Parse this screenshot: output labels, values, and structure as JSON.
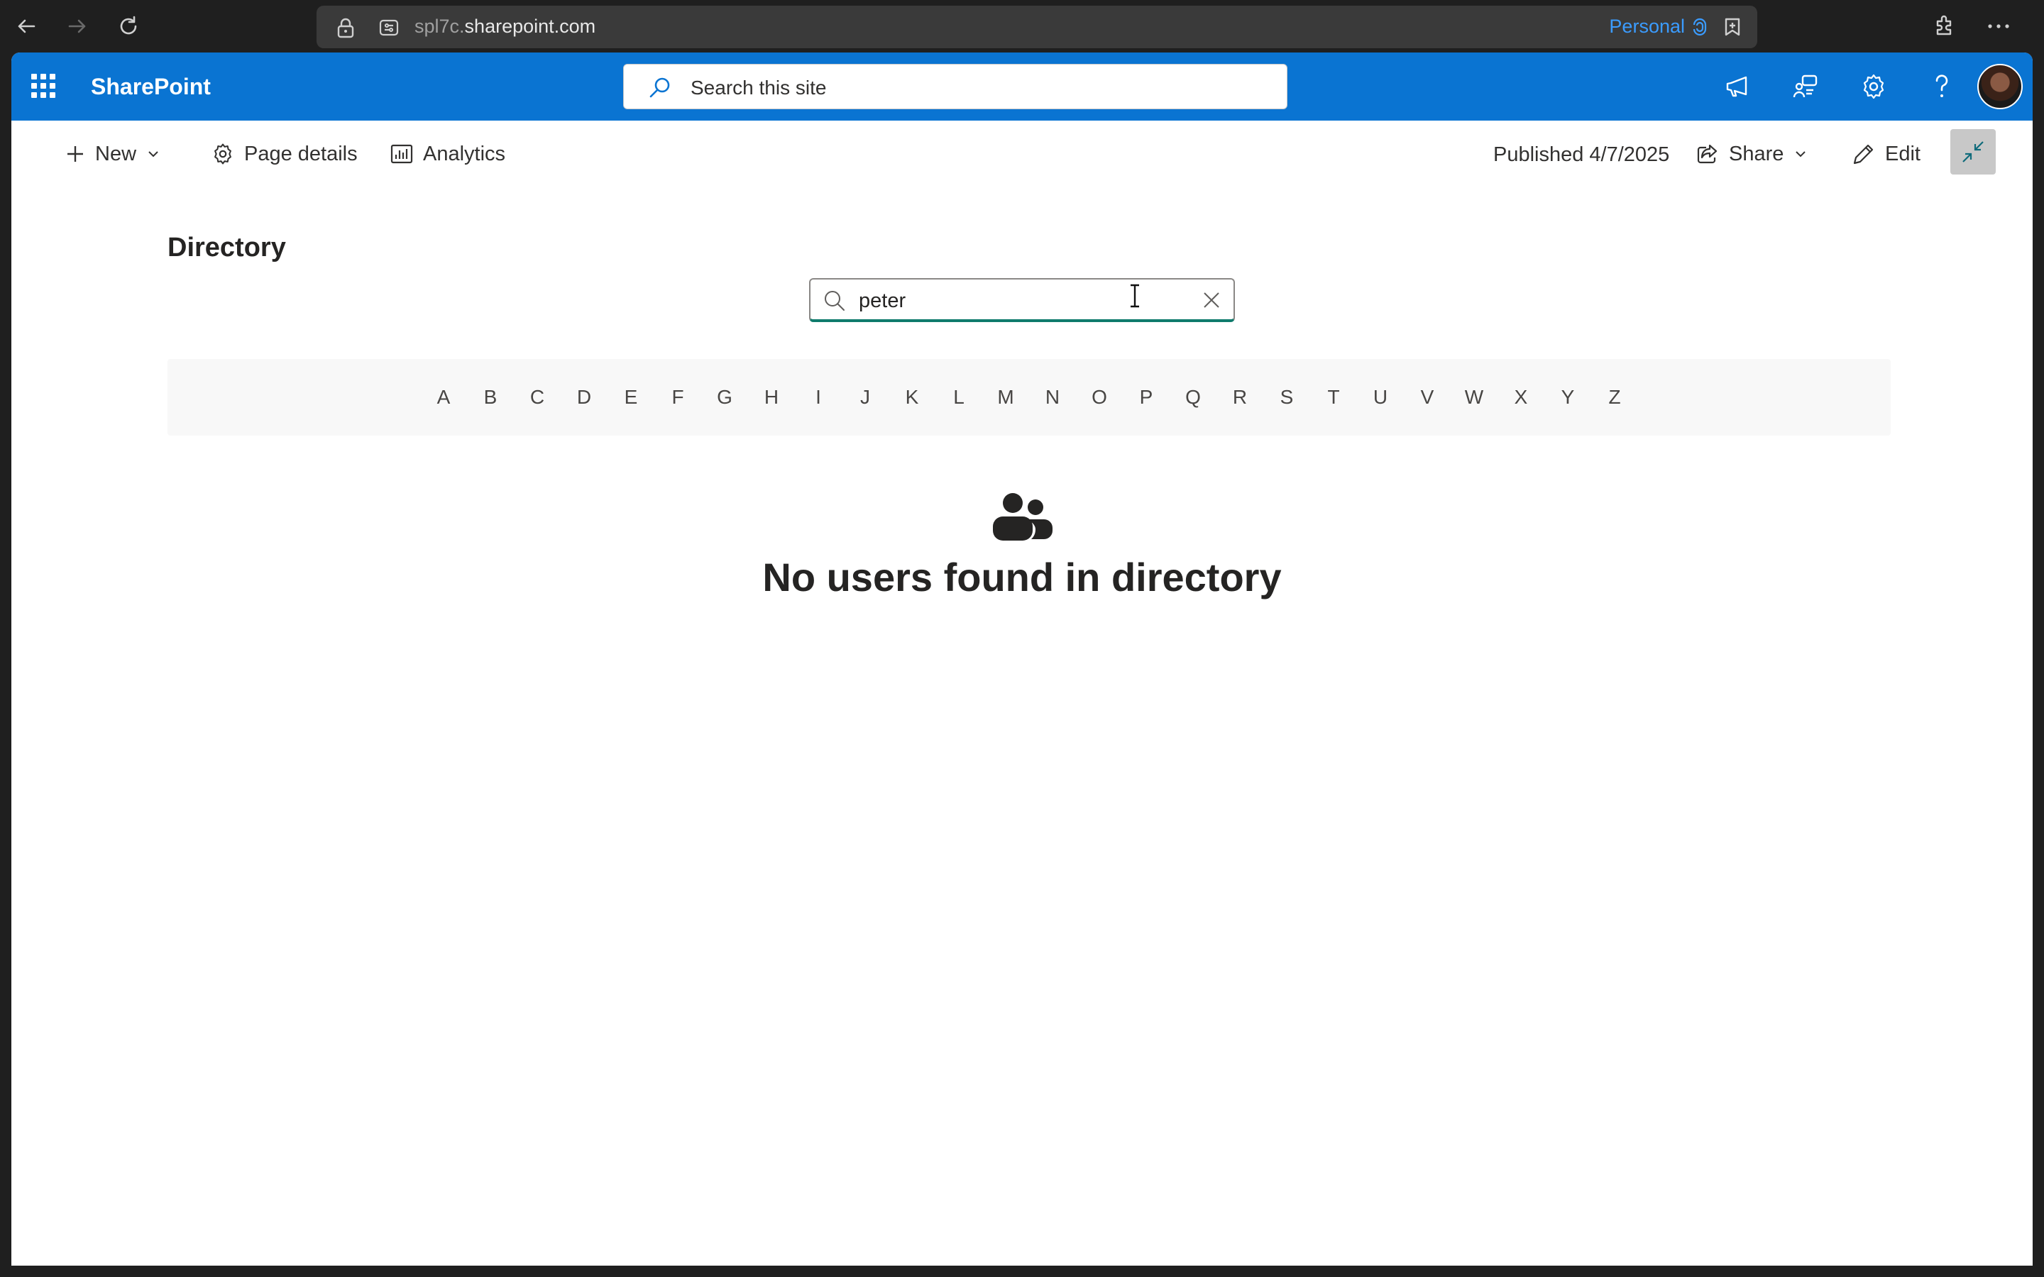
{
  "browser": {
    "url_subdomain": "spl7c.",
    "url_domain": "sharepoint.com",
    "profile_label": "Personal"
  },
  "suite": {
    "brand": "SharePoint",
    "search_placeholder": "Search this site"
  },
  "commands": {
    "new_label": "New",
    "page_details_label": "Page details",
    "analytics_label": "Analytics",
    "published_label": "Published 4/7/2025",
    "share_label": "Share",
    "edit_label": "Edit"
  },
  "directory": {
    "title": "Directory",
    "search_value": "peter",
    "letters": [
      "A",
      "B",
      "C",
      "D",
      "E",
      "F",
      "G",
      "H",
      "I",
      "J",
      "K",
      "L",
      "M",
      "N",
      "O",
      "P",
      "Q",
      "R",
      "S",
      "T",
      "U",
      "V",
      "W",
      "X",
      "Y",
      "Z"
    ],
    "empty_message": "No users found in directory"
  },
  "colors": {
    "suite_bar": "#0a74d2",
    "search_underline": "#0f7b6c",
    "profile_accent": "#3b9cff"
  }
}
